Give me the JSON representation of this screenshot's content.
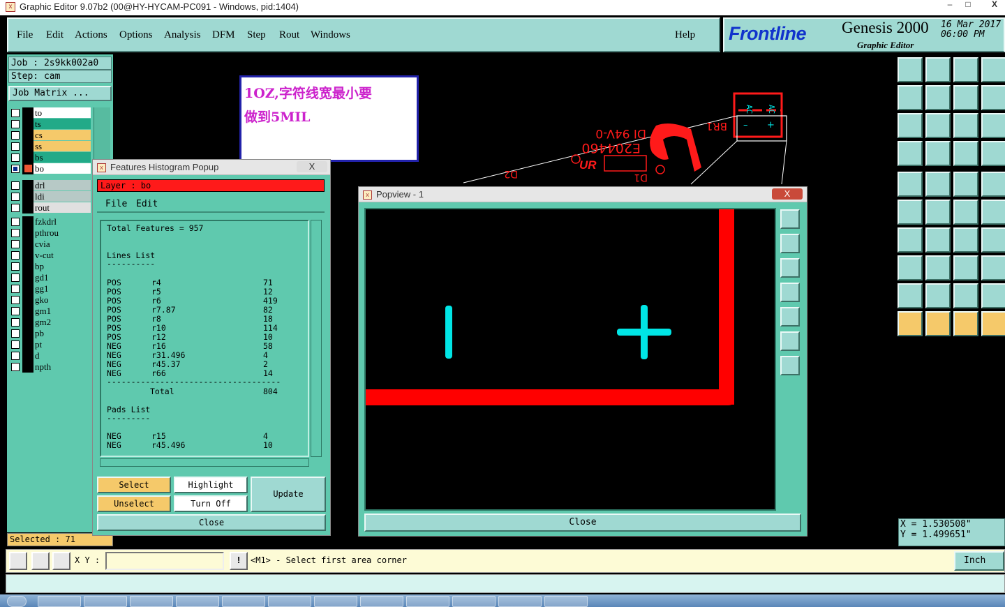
{
  "window": {
    "title": "Graphic Editor 9.07b2 (00@HY-HYCAM-PC091 - Windows, pid:1404)",
    "minimize": "–",
    "maximize": "□",
    "close": "X"
  },
  "menu": {
    "items": [
      "File",
      "Edit",
      "Actions",
      "Options",
      "Analysis",
      "DFM",
      "Step",
      "Rout",
      "Windows"
    ],
    "help": "Help"
  },
  "brand": {
    "logo": "Frontline",
    "product": "Genesis 2000",
    "subtitle": "Graphic Editor",
    "date_line1": "16 Mar 2017",
    "date_line2": "06:00 PM"
  },
  "job": {
    "job_label": "Job  : 2s9kk002a0",
    "step_label": "Step: cam",
    "matrix_button": "Job Matrix ..."
  },
  "layers": [
    {
      "name": "to",
      "color": "#ffffff"
    },
    {
      "name": "ts",
      "color": "#22aa88"
    },
    {
      "name": "cs",
      "color": "#f5c96a"
    },
    {
      "name": "ss",
      "color": "#f5c96a"
    },
    {
      "name": "bs",
      "color": "#22aa88"
    },
    {
      "name": "bo",
      "color": "#ffffff"
    },
    {
      "name": "drl",
      "color": "#b7c9c6"
    },
    {
      "name": "ldi",
      "color": "#b7c9c6"
    },
    {
      "name": "rout",
      "color": "#e0e0e0"
    },
    {
      "name": "fzkdrl",
      "color": "#5fc9ae"
    },
    {
      "name": "pthrou",
      "color": "#5fc9ae"
    },
    {
      "name": "cvia",
      "color": "#5fc9ae"
    },
    {
      "name": "v-cut",
      "color": "#5fc9ae"
    },
    {
      "name": "bp",
      "color": "#5fc9ae"
    },
    {
      "name": "gd1",
      "color": "#5fc9ae"
    },
    {
      "name": "gg1",
      "color": "#5fc9ae"
    },
    {
      "name": "gko",
      "color": "#5fc9ae"
    },
    {
      "name": "gm1",
      "color": "#5fc9ae"
    },
    {
      "name": "gm2",
      "color": "#5fc9ae"
    },
    {
      "name": "pb",
      "color": "#5fc9ae"
    },
    {
      "name": "pt",
      "color": "#5fc9ae"
    },
    {
      "name": "d",
      "color": "#5fc9ae"
    },
    {
      "name": "npth",
      "color": "#5fc9ae"
    }
  ],
  "selected_count": "Selected : 71",
  "note": {
    "line1": "1OZ,字符线宽最小要",
    "line2": "做到5MIL"
  },
  "board_text": {
    "part_no": "E204460",
    "rating": "DI 94V-0",
    "ref_br": "BR1",
    "ref_d2": "D2",
    "ref_d1": "D1",
    "ac1": "AC",
    "ac2": "AC",
    "minus": "–",
    "plus": "+"
  },
  "histogram": {
    "title": "Features Histogram Popup",
    "close_x": "X",
    "layer": "Layer :  bo",
    "menu": [
      "File",
      "Edit"
    ],
    "total": "Total Features = 957",
    "lines_heading": "Lines List",
    "pads_heading": "Pads List",
    "underline": "----------",
    "pads_underline": "---------",
    "lines": [
      {
        "pol": "POS",
        "sym": "r4",
        "count": "71"
      },
      {
        "pol": "POS",
        "sym": "r5",
        "count": "12"
      },
      {
        "pol": "POS",
        "sym": "r6",
        "count": "419"
      },
      {
        "pol": "POS",
        "sym": "r7.87",
        "count": "82"
      },
      {
        "pol": "POS",
        "sym": "r8",
        "count": "18"
      },
      {
        "pol": "POS",
        "sym": "r10",
        "count": "114"
      },
      {
        "pol": "POS",
        "sym": "r12",
        "count": "10"
      },
      {
        "pol": "NEG",
        "sym": "r16",
        "count": "58"
      },
      {
        "pol": "NEG",
        "sym": "r31.496",
        "count": "4"
      },
      {
        "pol": "NEG",
        "sym": "r45.37",
        "count": "2"
      },
      {
        "pol": "NEG",
        "sym": "r66",
        "count": "14"
      }
    ],
    "separator": "------------------------------------",
    "total_label": "Total",
    "total_value": "804",
    "pads": [
      {
        "pol": "NEG",
        "sym": "r15",
        "count": "4"
      },
      {
        "pol": "NEG",
        "sym": "r45.496",
        "count": "10"
      }
    ],
    "buttons": {
      "select": "Select",
      "highlight": "Highlight",
      "unselect": "Unselect",
      "turn_off": "Turn Off",
      "update": "Update",
      "close": "Close"
    }
  },
  "popview": {
    "title": "Popview - 1",
    "close_x": "X",
    "close_button": "Close"
  },
  "coords": {
    "x": "X  =  1.530508\"",
    "y": "Y  =  1.499651\""
  },
  "command": {
    "xy_label": "X Y :",
    "input_value": "",
    "alert": "!",
    "message": "<M1> - Select first area corner",
    "unit": "Inch"
  },
  "colors": {
    "panel": "#9fd9d2",
    "panel_dark": "#5fc9ae",
    "feature_red": "#ff0000",
    "feature_cyan": "#00e5e5",
    "note_text": "#cc22cc"
  }
}
